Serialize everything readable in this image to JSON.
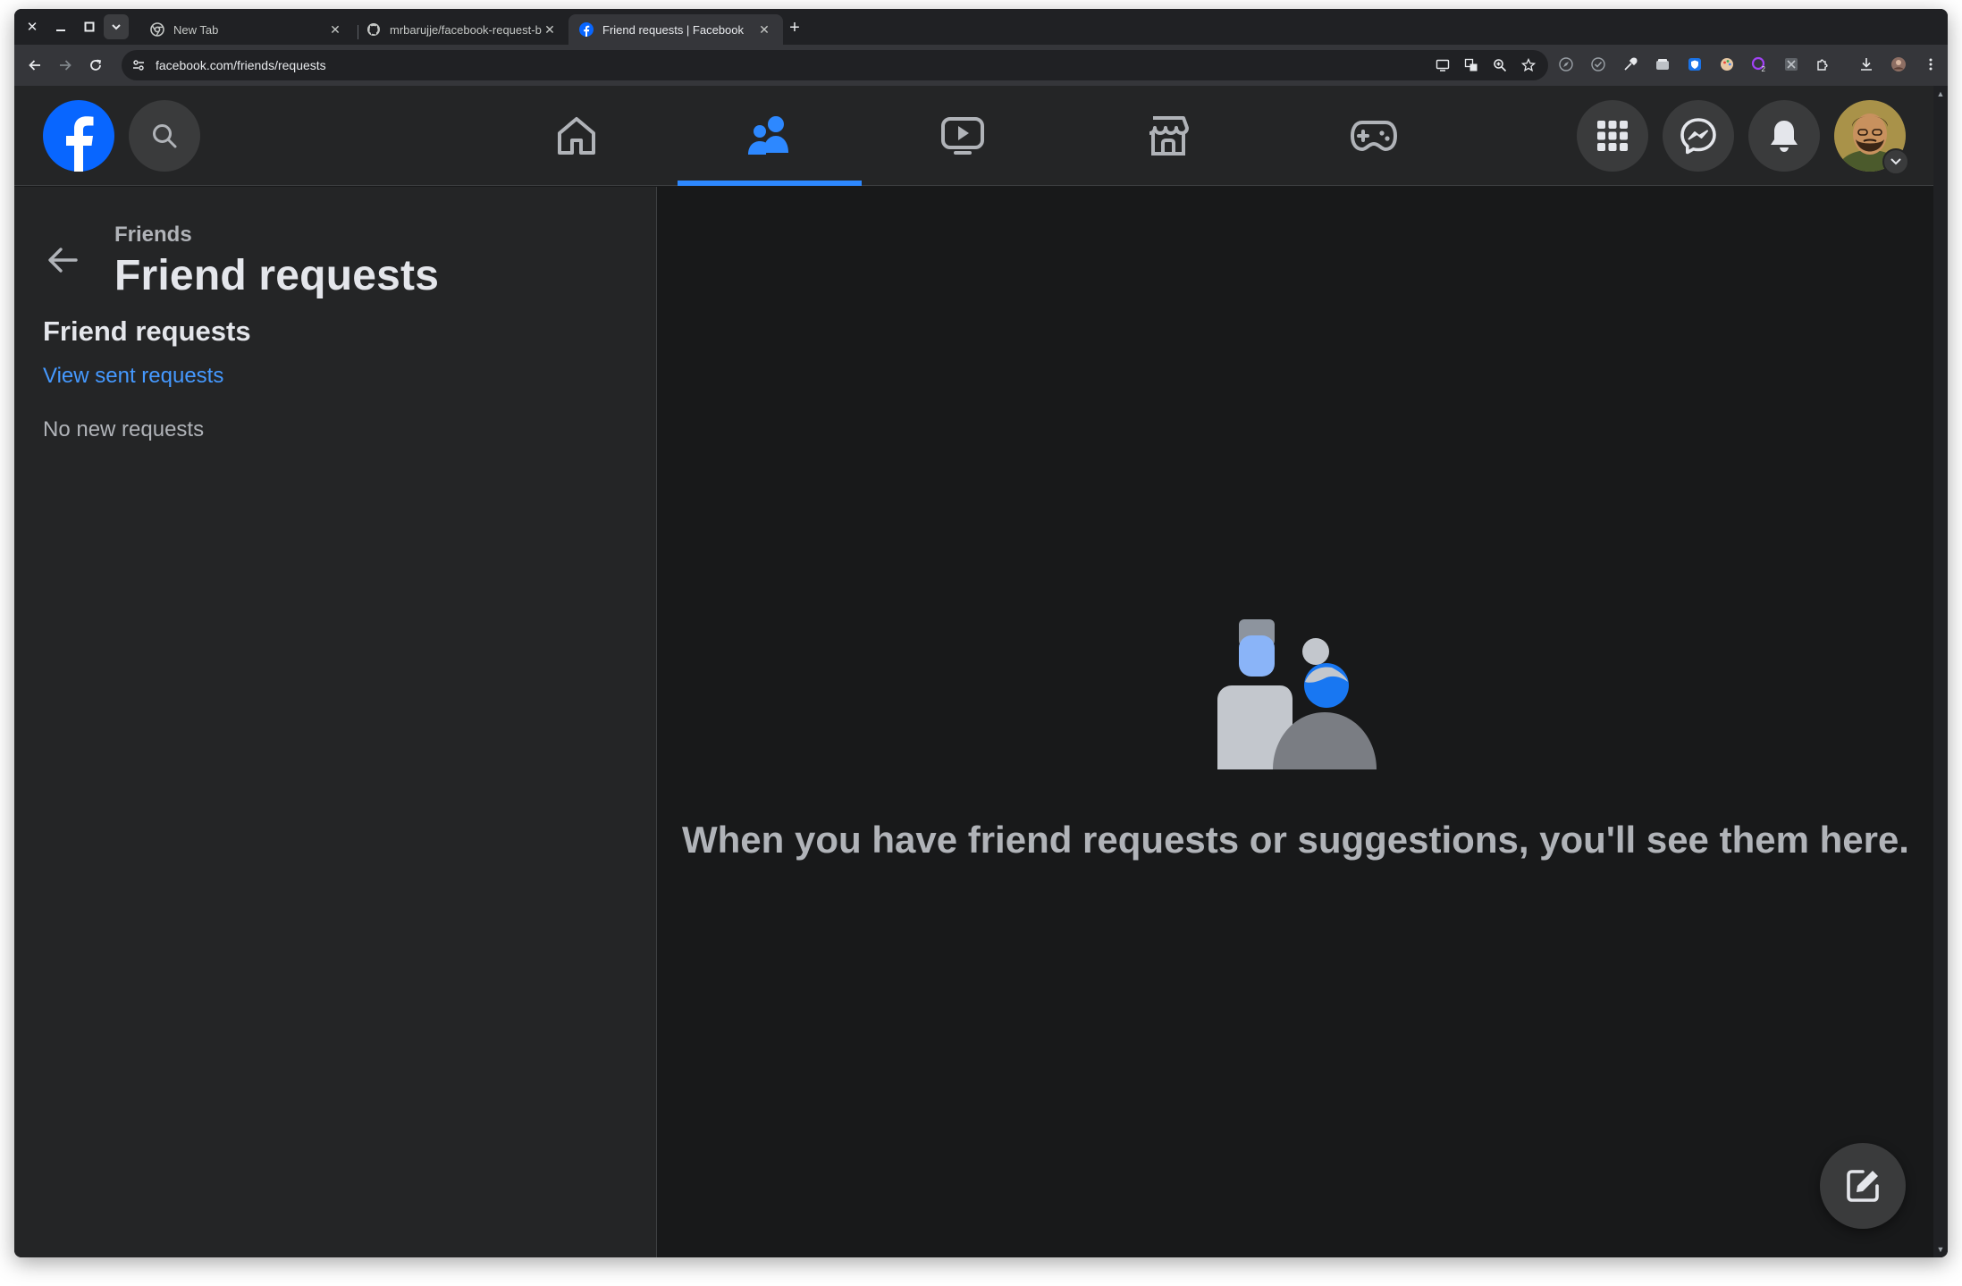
{
  "browser": {
    "tabs": [
      {
        "title": "New Tab",
        "favicon": "chrome-icon"
      },
      {
        "title": "mrbarujje/facebook-request-b",
        "favicon": "github-icon"
      },
      {
        "title": "Friend requests | Facebook",
        "favicon": "facebook-icon"
      }
    ],
    "active_tab": 2,
    "url": "facebook.com/friends/requests"
  },
  "fb": {
    "nav": {
      "items": [
        "home-icon",
        "friends-icon",
        "watch-icon",
        "marketplace-icon",
        "gaming-icon"
      ],
      "active": "friends-icon"
    },
    "colors": {
      "accent": "#2d88ff",
      "brand": "#0866ff",
      "link": "#4599ff"
    }
  },
  "sidebar": {
    "breadcrumb": "Friends",
    "title": "Friend requests",
    "section_title": "Friend requests",
    "sent_link": "View sent requests",
    "empty": "No new requests"
  },
  "main": {
    "empty_message": "When you have friend requests or suggestions, you'll see them here."
  }
}
